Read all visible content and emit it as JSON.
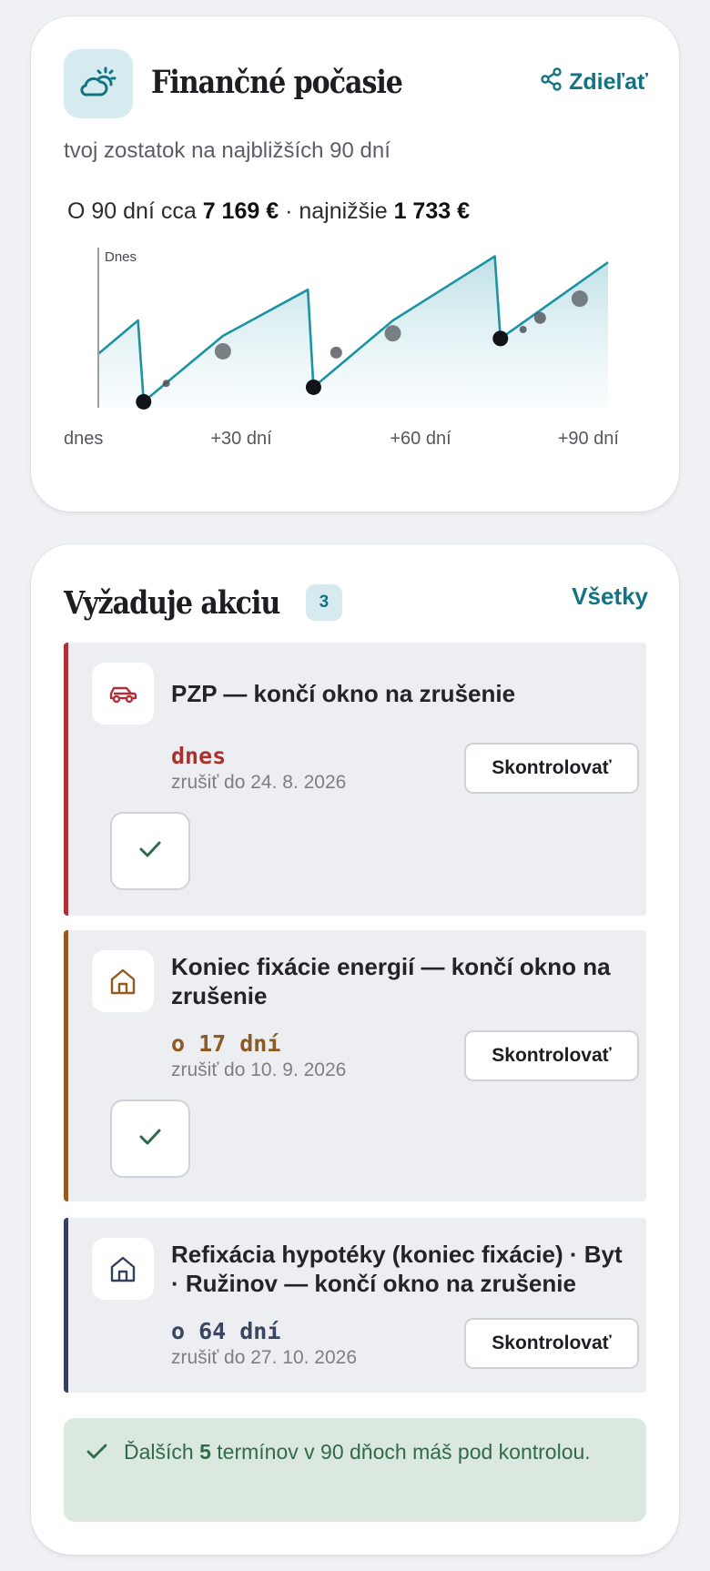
{
  "weather": {
    "title": "Finančné počasie",
    "icon": "sun-cloud-icon",
    "share_label": "Zdieľať",
    "share_icon": "share-icon",
    "subtitle": "tvoj zostatok na najbližších 90 dní",
    "summary_prefix": "O 90 dní cca ",
    "summary_end_value": "7 169 €",
    "summary_mid": " · najnižšie ",
    "summary_min_value": "1 733 €",
    "today_label": "Dnes"
  },
  "chart_data": {
    "type": "area",
    "xlabel": "",
    "ylabel": "",
    "x_ticks": [
      "dnes",
      "+30 dní",
      "+60 dní",
      "+90 dní"
    ],
    "xlim": [
      0,
      90
    ],
    "ylim": [
      1500,
      7600
    ],
    "vertical_marker": {
      "x": 0,
      "label": "Dnes"
    },
    "series": [
      {
        "values": [
          {
            "x": 0,
            "y": 3600
          },
          {
            "x": 7,
            "y": 4900
          },
          {
            "x": 8,
            "y": 1733
          },
          {
            "x": 22,
            "y": 4300
          },
          {
            "x": 37,
            "y": 6100
          },
          {
            "x": 38,
            "y": 2300
          },
          {
            "x": 52,
            "y": 4900
          },
          {
            "x": 70,
            "y": 7400
          },
          {
            "x": 71,
            "y": 4200
          },
          {
            "x": 90,
            "y": 7169
          }
        ]
      }
    ],
    "event_markers": [
      {
        "x": 8,
        "y": 1733,
        "kind": "low"
      },
      {
        "x": 12,
        "y": 2450,
        "kind": "small"
      },
      {
        "x": 22,
        "y": 3700,
        "kind": "large"
      },
      {
        "x": 38,
        "y": 2300,
        "kind": "low"
      },
      {
        "x": 42,
        "y": 3650,
        "kind": "medium"
      },
      {
        "x": 52,
        "y": 4400,
        "kind": "large"
      },
      {
        "x": 71,
        "y": 4200,
        "kind": "low"
      },
      {
        "x": 75,
        "y": 4550,
        "kind": "small"
      },
      {
        "x": 78,
        "y": 5000,
        "kind": "medium"
      },
      {
        "x": 85,
        "y": 5750,
        "kind": "large"
      }
    ]
  },
  "actions": {
    "title": "Vyžaduje akciu",
    "count": "3",
    "all_label": "Všetky",
    "items": [
      {
        "title": "PZP — končí okno na zrušenie",
        "icon": "car-icon",
        "due": "dnes",
        "deadline": "zrušiť do 24. 8. 2026",
        "button": "Skontrolovať",
        "accent": "#b0303a",
        "due_color": "#a8332e",
        "has_check": true
      },
      {
        "title": "Koniec fixácie energií — končí okno na zrušenie",
        "icon": "house-icon",
        "due": "o 17 dní",
        "deadline": "zrušiť do 10. 9. 2026",
        "button": "Skontrolovať",
        "accent": "#955a1d",
        "due_color": "#8c5a23",
        "has_check": true
      },
      {
        "title": "Refixácia hypotéky (koniec fixácie) · Byt · Ružinov — končí okno na zrušenie",
        "icon": "house-icon",
        "due": "o 64 dní",
        "deadline": "zrušiť do 27. 10. 2026",
        "button": "Skontrolovať",
        "accent": "#34405c",
        "due_color": "#3a4660",
        "has_check": false
      }
    ],
    "footer": {
      "prefix": "Ďalších ",
      "count": "5",
      "suffix": " termínov v 90 dňoch máš pod kontrolou.",
      "icon": "check-icon"
    }
  }
}
